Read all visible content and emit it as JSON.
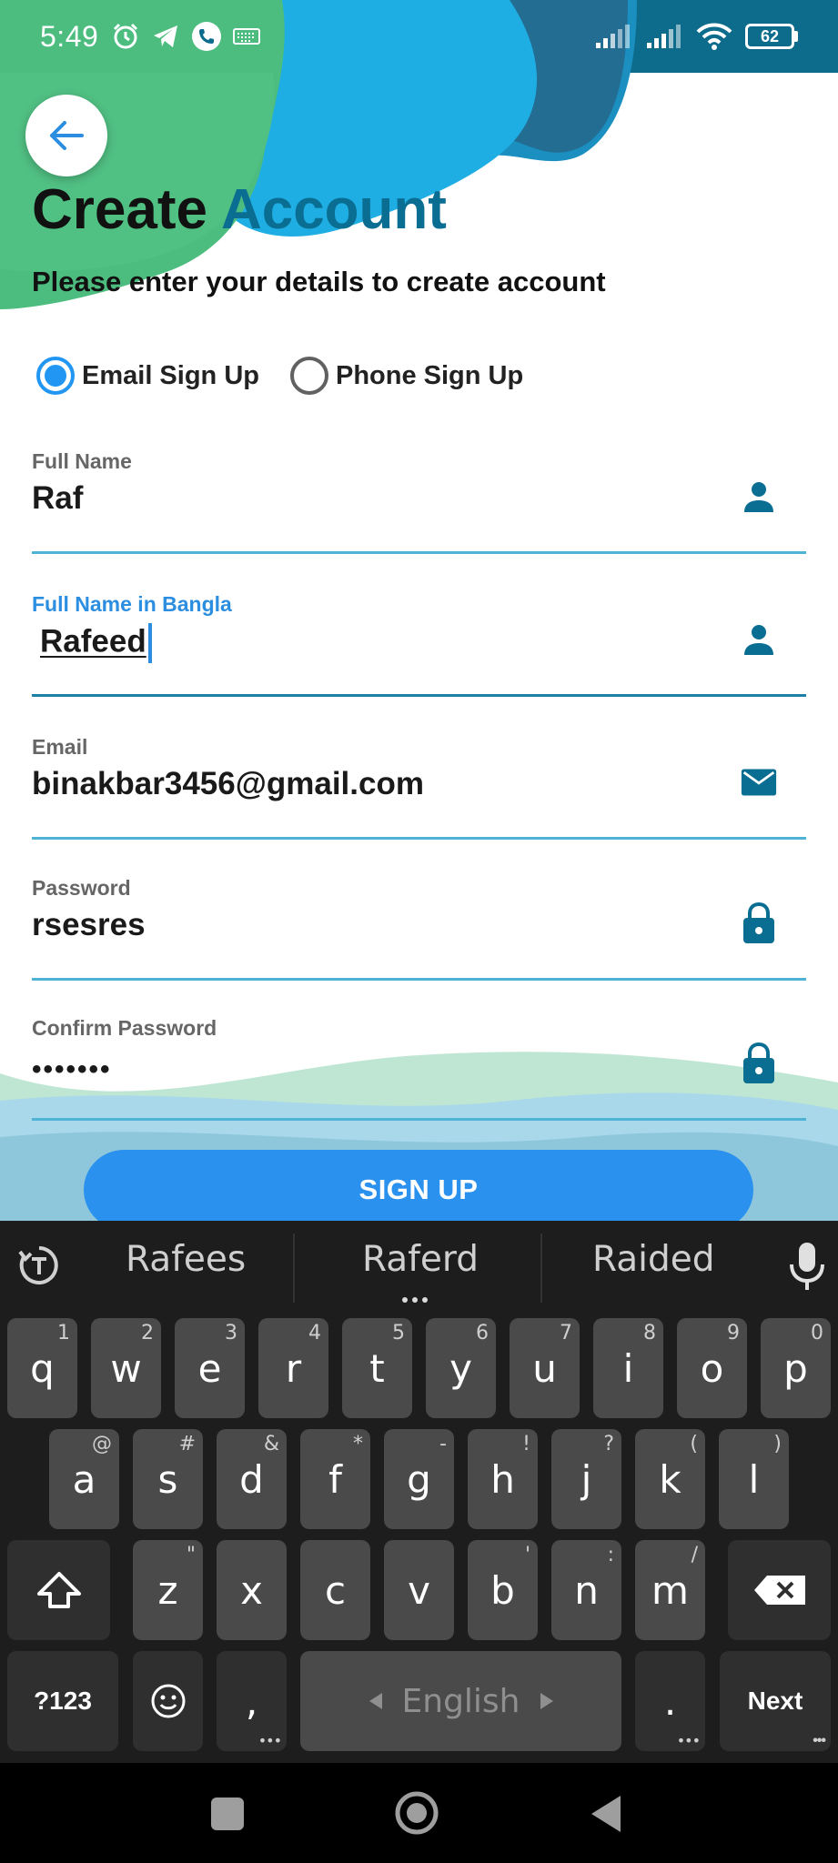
{
  "status_bar": {
    "time": "5:49",
    "left_icons": [
      "alarm-icon",
      "telegram-icon",
      "phone-call-icon",
      "keyboard-icon"
    ],
    "right_icons": [
      "signal-icon",
      "signal-icon",
      "wifi-icon"
    ],
    "battery": "62"
  },
  "header": {
    "back_icon": "arrow-left-icon",
    "title_part1": "Create",
    "title_part2": "Account",
    "subtitle": "Please enter your details to create account"
  },
  "signup_type": {
    "options": [
      {
        "label": "Email Sign Up",
        "selected": true
      },
      {
        "label": "Phone Sign Up",
        "selected": false
      }
    ]
  },
  "form": {
    "full_name": {
      "label": "Full Name",
      "value": "Raf",
      "icon": "person-icon"
    },
    "full_name_bangla": {
      "label": "Full Name in Bangla",
      "value": "Rafeed",
      "icon": "person-icon",
      "focused": true
    },
    "email": {
      "label": "Email",
      "value": "binakbar3456@gmail.com",
      "icon": "mail-icon"
    },
    "password": {
      "label": "Password",
      "value": "rsesres",
      "icon": "lock-icon"
    },
    "confirm_password": {
      "label": "Confirm Password",
      "value": "•••••••",
      "icon": "lock-icon"
    }
  },
  "signup_button": {
    "label": "SIGN UP"
  },
  "keyboard": {
    "suggestions": [
      "Rafees",
      "Raferd",
      "Raided"
    ],
    "row1": [
      {
        "key": "q",
        "hint": "1"
      },
      {
        "key": "w",
        "hint": "2"
      },
      {
        "key": "e",
        "hint": "3"
      },
      {
        "key": "r",
        "hint": "4"
      },
      {
        "key": "t",
        "hint": "5"
      },
      {
        "key": "y",
        "hint": "6"
      },
      {
        "key": "u",
        "hint": "7"
      },
      {
        "key": "i",
        "hint": "8"
      },
      {
        "key": "o",
        "hint": "9"
      },
      {
        "key": "p",
        "hint": "0"
      }
    ],
    "row2": [
      {
        "key": "a",
        "hint": "@"
      },
      {
        "key": "s",
        "hint": "#"
      },
      {
        "key": "d",
        "hint": "&"
      },
      {
        "key": "f",
        "hint": "*"
      },
      {
        "key": "g",
        "hint": "-"
      },
      {
        "key": "h",
        "hint": "!"
      },
      {
        "key": "j",
        "hint": "?"
      },
      {
        "key": "k",
        "hint": "("
      },
      {
        "key": "l",
        "hint": ")"
      }
    ],
    "row3": [
      {
        "key": "z",
        "hint": "\""
      },
      {
        "key": "x",
        "hint": ""
      },
      {
        "key": "c",
        "hint": ""
      },
      {
        "key": "v",
        "hint": ""
      },
      {
        "key": "b",
        "hint": "'"
      },
      {
        "key": "n",
        "hint": ":"
      },
      {
        "key": "m",
        "hint": "/"
      }
    ],
    "symbols_label": "?123",
    "comma_label": ",",
    "space_label": "English",
    "period_label": ".",
    "action_label": "Next"
  },
  "colors": {
    "accent": "#2b91ee",
    "title_accent": "#0a6e92",
    "icon": "#0a6e92"
  }
}
